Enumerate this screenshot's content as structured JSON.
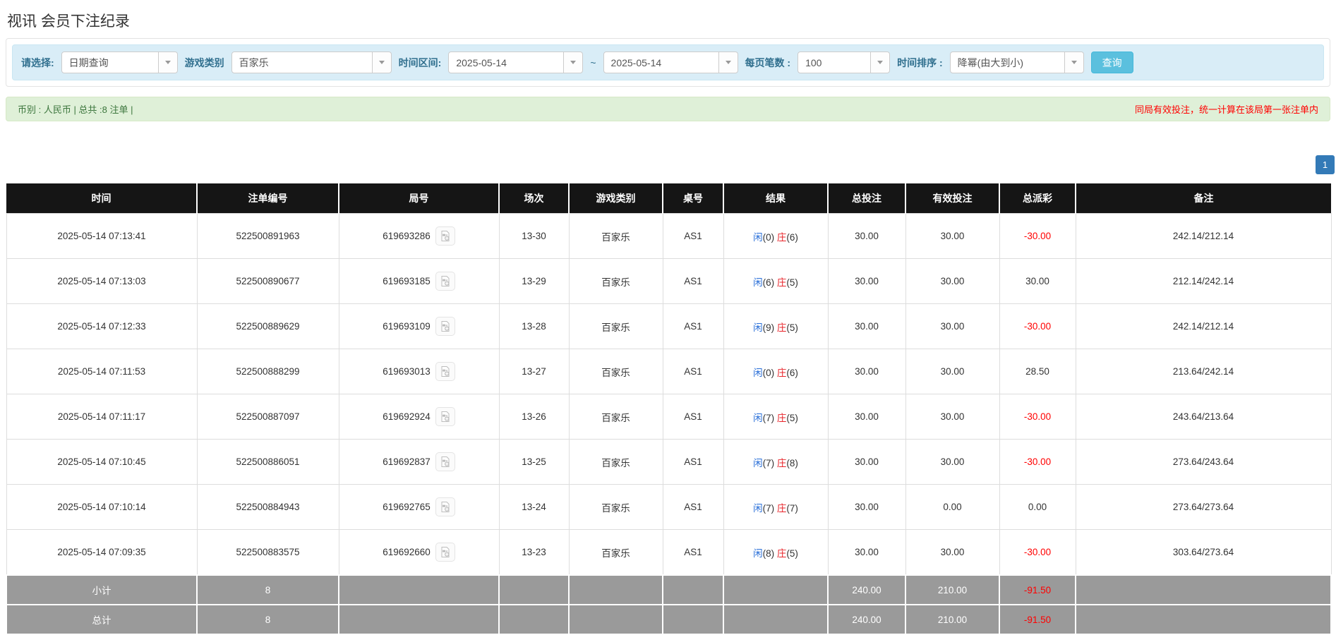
{
  "page": {
    "title": "视讯 会员下注纪录"
  },
  "filters": {
    "mode_label": "请选择:",
    "mode_value": "日期查询",
    "game_label": "游戏类别",
    "game_value": "百家乐",
    "range_label": "时间区间:",
    "date_from": "2025-05-14",
    "tilde": "~",
    "date_to": "2025-05-14",
    "per_page_label": "每页笔数 :",
    "per_page_value": "100",
    "sort_label": "时间排序 :",
    "sort_value": "降幂(由大到小)",
    "search_button": "查询"
  },
  "summary": {
    "left": "币别 : 人民币 | 总共 :8 注单 |",
    "right": "同局有效投注，统一计算在该局第一张注单内"
  },
  "pagination": {
    "current": "1"
  },
  "table": {
    "headers": [
      "时间",
      "注单编号",
      "局号",
      "场次",
      "游戏类别",
      "桌号",
      "结果",
      "总投注",
      "有效投注",
      "总派彩",
      "备注"
    ],
    "rows": [
      {
        "time": "2025-05-14 07:13:41",
        "bet_id": "522500891963",
        "round_id": "619693286",
        "session": "13-30",
        "game": "百家乐",
        "table_id": "AS1",
        "player": "闲",
        "player_pts": "(0)",
        "banker": "庄",
        "banker_pts": "(6)",
        "total_bet": "30.00",
        "valid_bet": "30.00",
        "payout": "-30.00",
        "remark": "242.14/212.14"
      },
      {
        "time": "2025-05-14 07:13:03",
        "bet_id": "522500890677",
        "round_id": "619693185",
        "session": "13-29",
        "game": "百家乐",
        "table_id": "AS1",
        "player": "闲",
        "player_pts": "(6)",
        "banker": "庄",
        "banker_pts": "(5)",
        "total_bet": "30.00",
        "valid_bet": "30.00",
        "payout": "30.00",
        "remark": "212.14/242.14"
      },
      {
        "time": "2025-05-14 07:12:33",
        "bet_id": "522500889629",
        "round_id": "619693109",
        "session": "13-28",
        "game": "百家乐",
        "table_id": "AS1",
        "player": "闲",
        "player_pts": "(9)",
        "banker": "庄",
        "banker_pts": "(5)",
        "total_bet": "30.00",
        "valid_bet": "30.00",
        "payout": "-30.00",
        "remark": "242.14/212.14"
      },
      {
        "time": "2025-05-14 07:11:53",
        "bet_id": "522500888299",
        "round_id": "619693013",
        "session": "13-27",
        "game": "百家乐",
        "table_id": "AS1",
        "player": "闲",
        "player_pts": "(0)",
        "banker": "庄",
        "banker_pts": "(6)",
        "total_bet": "30.00",
        "valid_bet": "30.00",
        "payout": "28.50",
        "remark": "213.64/242.14"
      },
      {
        "time": "2025-05-14 07:11:17",
        "bet_id": "522500887097",
        "round_id": "619692924",
        "session": "13-26",
        "game": "百家乐",
        "table_id": "AS1",
        "player": "闲",
        "player_pts": "(7)",
        "banker": "庄",
        "banker_pts": "(5)",
        "total_bet": "30.00",
        "valid_bet": "30.00",
        "payout": "-30.00",
        "remark": "243.64/213.64"
      },
      {
        "time": "2025-05-14 07:10:45",
        "bet_id": "522500886051",
        "round_id": "619692837",
        "session": "13-25",
        "game": "百家乐",
        "table_id": "AS1",
        "player": "闲",
        "player_pts": "(7)",
        "banker": "庄",
        "banker_pts": "(8)",
        "total_bet": "30.00",
        "valid_bet": "30.00",
        "payout": "-30.00",
        "remark": "273.64/243.64"
      },
      {
        "time": "2025-05-14 07:10:14",
        "bet_id": "522500884943",
        "round_id": "619692765",
        "session": "13-24",
        "game": "百家乐",
        "table_id": "AS1",
        "player": "闲",
        "player_pts": "(7)",
        "banker": "庄",
        "banker_pts": "(7)",
        "total_bet": "30.00",
        "valid_bet": "0.00",
        "payout": "0.00",
        "remark": "273.64/273.64"
      },
      {
        "time": "2025-05-14 07:09:35",
        "bet_id": "522500883575",
        "round_id": "619692660",
        "session": "13-23",
        "game": "百家乐",
        "table_id": "AS1",
        "player": "闲",
        "player_pts": "(8)",
        "banker": "庄",
        "banker_pts": "(5)",
        "total_bet": "30.00",
        "valid_bet": "30.00",
        "payout": "-30.00",
        "remark": "303.64/273.64"
      }
    ],
    "subtotal": {
      "label": "小计",
      "count": "8",
      "total_bet": "240.00",
      "valid_bet": "210.00",
      "payout": "-91.50"
    },
    "total": {
      "label": "总计",
      "count": "8",
      "total_bet": "240.00",
      "valid_bet": "210.00",
      "payout": "-91.50"
    }
  },
  "colors": {
    "accent_blue": "#2a6fd8",
    "banker_red": "#e8242a",
    "negative_red": "#ff0000",
    "search_button_blue": "#5bc0de",
    "pagination_blue": "#337ab7",
    "table_header_bg": "#151515",
    "table_footer_bg": "#9a9a9a",
    "filter_bar_bg": "#d9edf7",
    "summary_bar_bg": "#dff0d8",
    "summary_text_green": "#3c763d"
  }
}
